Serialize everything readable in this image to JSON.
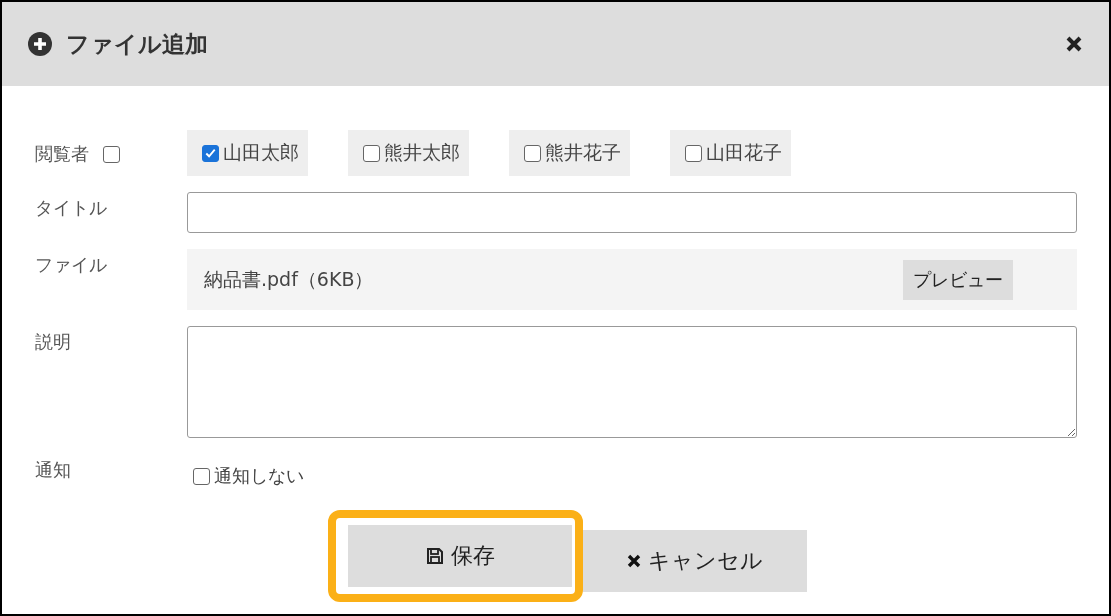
{
  "dialog": {
    "title": "ファイル追加"
  },
  "viewers": {
    "label": "閲覧者",
    "all_checked": false,
    "people": [
      {
        "name": "山田太郎",
        "checked": true
      },
      {
        "name": "熊井太郎",
        "checked": false
      },
      {
        "name": "熊井花子",
        "checked": false
      },
      {
        "name": "山田花子",
        "checked": false
      }
    ]
  },
  "title_field": {
    "label": "タイトル"
  },
  "file": {
    "label": "ファイル",
    "filename": "納品書.pdf（6KB）",
    "preview_button": "プレビュー"
  },
  "description": {
    "label": "説明"
  },
  "notify": {
    "label": "通知",
    "option": "通知しない",
    "checked": false
  },
  "buttons": [
    {
      "kind": "save",
      "label": "保存",
      "highlighted": true
    },
    {
      "kind": "cancel",
      "label": "キャンセル",
      "highlighted": false
    }
  ]
}
